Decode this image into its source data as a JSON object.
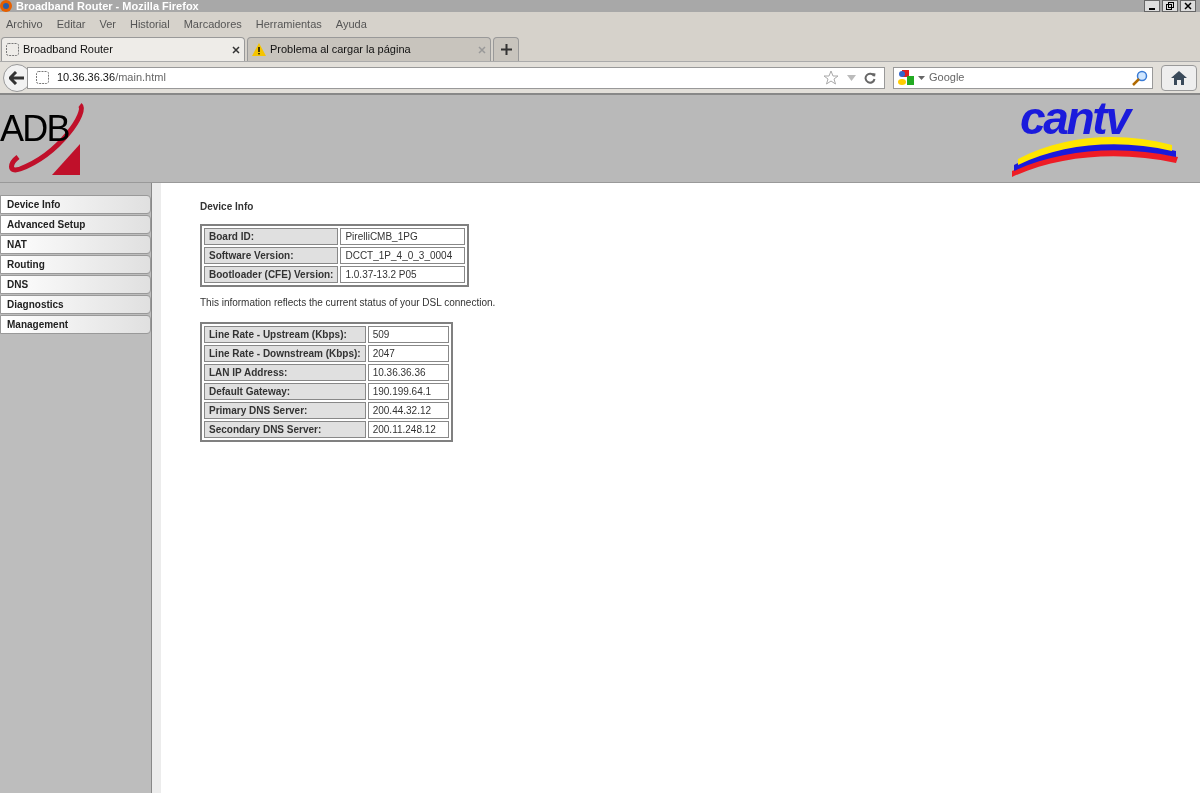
{
  "window": {
    "title": "Broadband Router - Mozilla Firefox"
  },
  "menu": [
    "Archivo",
    "Editar",
    "Ver",
    "Historial",
    "Marcadores",
    "Herramientas",
    "Ayuda"
  ],
  "tabs": [
    {
      "label": "Broadband Router",
      "selected": true,
      "kind": "page"
    },
    {
      "label": "Problema al cargar la página",
      "selected": false,
      "kind": "warning"
    }
  ],
  "address": {
    "host": "10.36.36.36",
    "path": "/main.html"
  },
  "search": {
    "placeholder": "Google"
  },
  "header": {
    "left_logo": "ADB",
    "right_logo": "cantv"
  },
  "sidebar": {
    "items": [
      "Device Info",
      "Advanced Setup",
      "NAT",
      "Routing",
      "DNS",
      "Diagnostics",
      "Management"
    ]
  },
  "content": {
    "title": "Device Info",
    "device_table": [
      {
        "label": "Board ID:",
        "value": "PirelliCMB_1PG"
      },
      {
        "label": "Software Version:",
        "value": "DCCT_1P_4_0_3_0004"
      },
      {
        "label": "Bootloader (CFE) Version:",
        "value": "1.0.37-13.2 P05"
      }
    ],
    "note": "This information reflects the current status of your DSL connection.",
    "status_table": [
      {
        "label": "Line Rate - Upstream (Kbps):",
        "value": "509"
      },
      {
        "label": "Line Rate - Downstream (Kbps):",
        "value": "2047"
      },
      {
        "label": "LAN IP Address:",
        "value": "10.36.36.36"
      },
      {
        "label": "Default Gateway:",
        "value": "190.199.64.1"
      },
      {
        "label": "Primary DNS Server:",
        "value": "200.44.32.12"
      },
      {
        "label": "Secondary DNS Server:",
        "value": "200.11.248.12"
      }
    ]
  }
}
